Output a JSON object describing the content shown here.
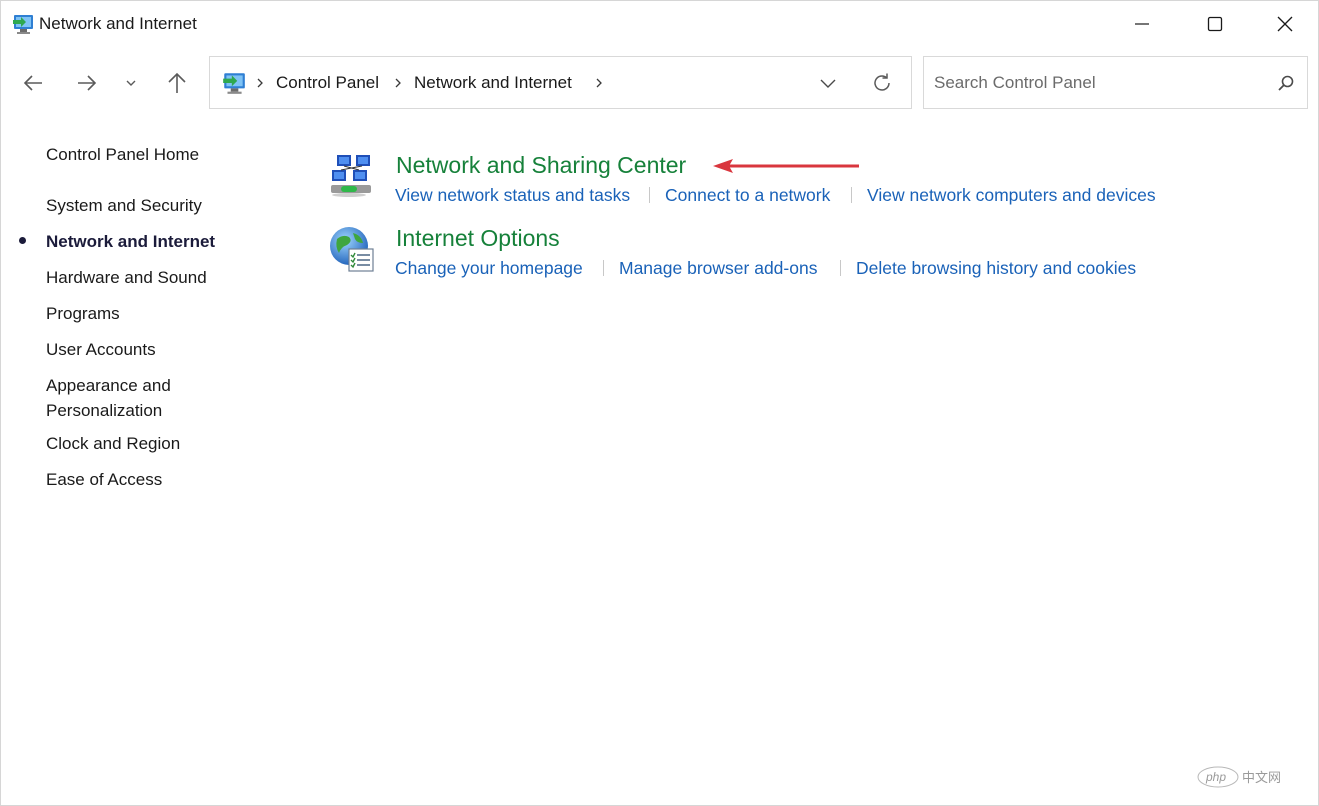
{
  "window": {
    "title": "Network and Internet",
    "controls": {
      "minimize": "minimize-icon",
      "maximize": "maximize-icon",
      "close": "close-icon"
    }
  },
  "nav": {
    "back": "back-arrow-icon",
    "forward": "forward-arrow-icon",
    "recent": "chevron-down-icon",
    "up": "up-arrow-icon"
  },
  "address": {
    "breadcrumbs": [
      "Control Panel",
      "Network and Internet"
    ],
    "dropdown_icon": "chevron-down-icon",
    "refresh_icon": "refresh-icon"
  },
  "search": {
    "placeholder": "Search Control Panel",
    "value": "",
    "icon": "search-icon"
  },
  "sidebar": {
    "items": [
      {
        "label": "Control Panel Home",
        "active": false
      },
      {
        "label": "System and Security",
        "active": false
      },
      {
        "label": "Network and Internet",
        "active": true
      },
      {
        "label": "Hardware and Sound",
        "active": false
      },
      {
        "label": "Programs",
        "active": false
      },
      {
        "label": "User Accounts",
        "active": false
      },
      {
        "label": "Appearance and Personalization",
        "line1": "Appearance and",
        "line2": "Personalization",
        "active": false
      },
      {
        "label": "Clock and Region",
        "active": false
      },
      {
        "label": "Ease of Access",
        "active": false
      }
    ]
  },
  "sections": [
    {
      "title": "Network and Sharing Center",
      "icon": "network-sharing-center-icon",
      "tasks": [
        "View network status and tasks",
        "Connect to a network",
        "View network computers and devices"
      ]
    },
    {
      "title": "Internet Options",
      "icon": "internet-options-globe-icon",
      "tasks": [
        "Change your homepage",
        "Manage browser add-ons",
        "Delete browsing history and cookies"
      ]
    }
  ],
  "annotation": {
    "icon": "red-arrow-annotation",
    "color": "#d9363e"
  },
  "watermark": {
    "brand": "php",
    "suffix": "中文网"
  },
  "colors": {
    "section_title": "#16813a",
    "task_link": "#1a62b8",
    "active_item": "#1b1b3a"
  }
}
